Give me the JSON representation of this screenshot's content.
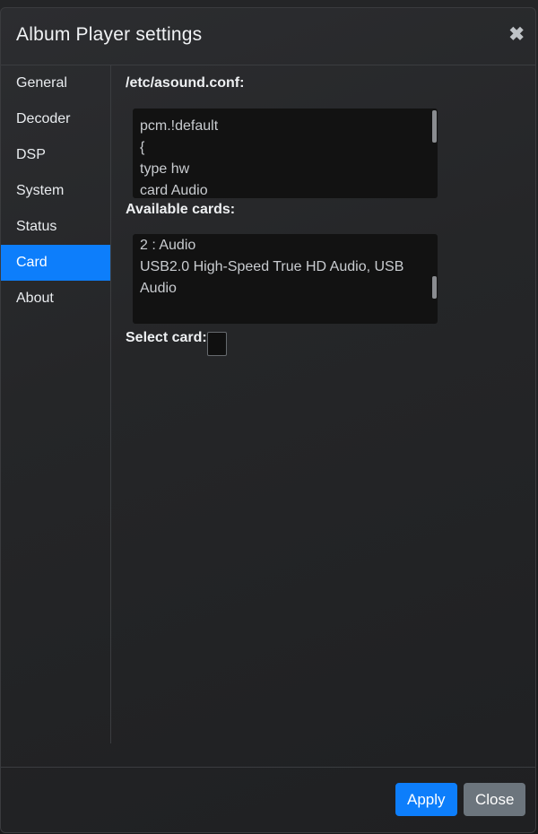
{
  "dialog": {
    "title": "Album Player settings",
    "close_symbol": "✖"
  },
  "sidebar": {
    "items": [
      {
        "label": "General",
        "active": false
      },
      {
        "label": "Decoder",
        "active": false
      },
      {
        "label": "DSP",
        "active": false
      },
      {
        "label": "System",
        "active": false
      },
      {
        "label": "Status",
        "active": false
      },
      {
        "label": "Card",
        "active": true
      },
      {
        "label": "About",
        "active": false
      }
    ]
  },
  "card": {
    "asound_label": "/etc/asound.conf:",
    "asound_lines": [
      "pcm.!default",
      "{",
      "type hw",
      "card Audio"
    ],
    "available_label": "Available cards:",
    "available_lines": [
      "2 : Audio",
      "USB2.0 High-Speed True HD Audio, USB Audio"
    ],
    "select_label": "Select card:",
    "select_value": ""
  },
  "footer": {
    "apply_label": "Apply",
    "close_label": "Close"
  },
  "colors": {
    "accent": "#0d7efb",
    "secondary": "#6c757d",
    "textbox_bg": "#121212"
  }
}
